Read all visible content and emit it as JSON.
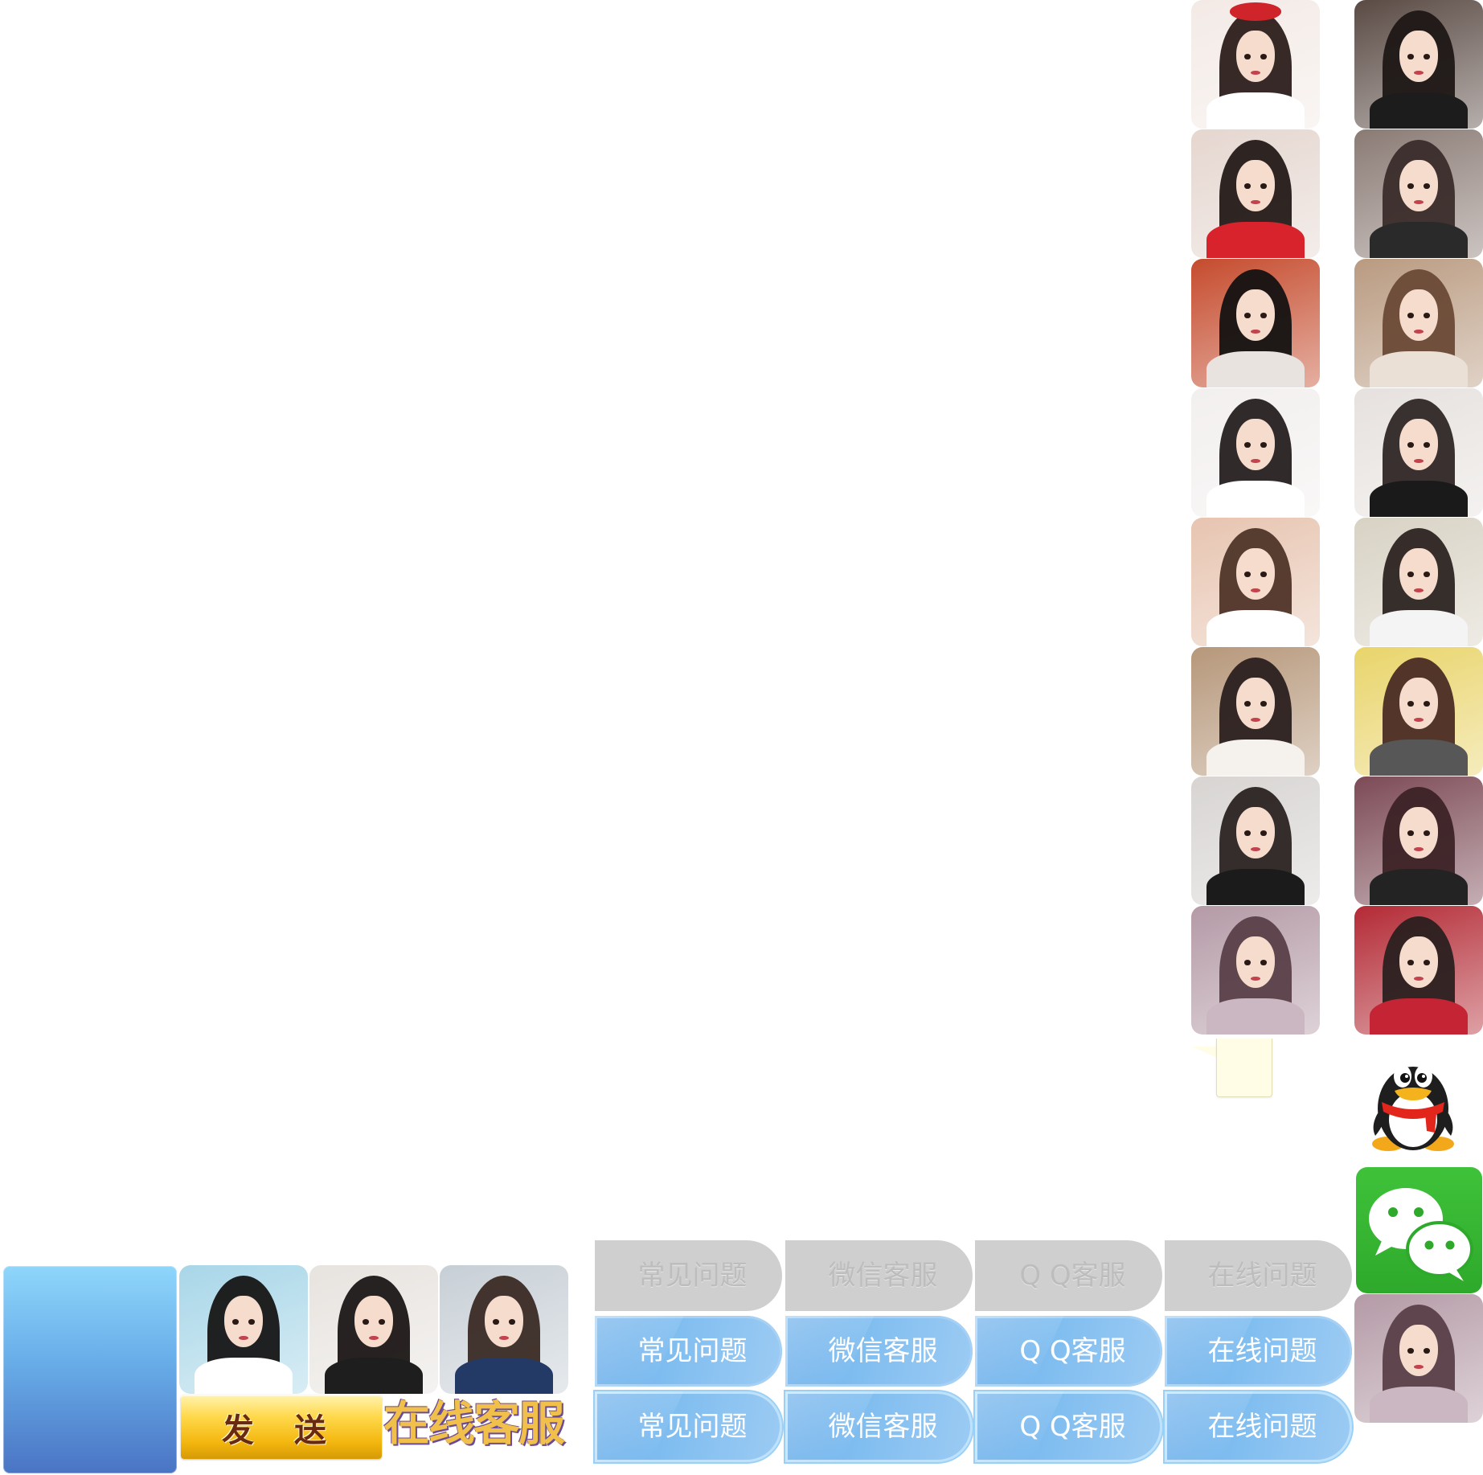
{
  "send_button": {
    "label": "发 送"
  },
  "wordart": {
    "text": "在线客服"
  },
  "tab_rows": [
    {
      "state": "normal",
      "items": [
        "常见问题",
        "微信客服",
        "Q Q客服",
        "在线问题"
      ]
    },
    {
      "state": "hover",
      "items": [
        "常见问题",
        "微信客服",
        "Q Q客服",
        "在线问题"
      ]
    },
    {
      "state": "active",
      "items": [
        "常见问题",
        "微信客服",
        "Q Q客服",
        "在线问题"
      ]
    }
  ],
  "icons": {
    "qq": "qq-penguin-icon",
    "wechat": "wechat-icon"
  },
  "colors": {
    "accent_blue": "#6aaeea",
    "gray_tab": "#cfcfcf",
    "wechat_green": "#3fc23a",
    "send_gold": "#ffd84a",
    "wordart_gold": "#f0c04a"
  }
}
